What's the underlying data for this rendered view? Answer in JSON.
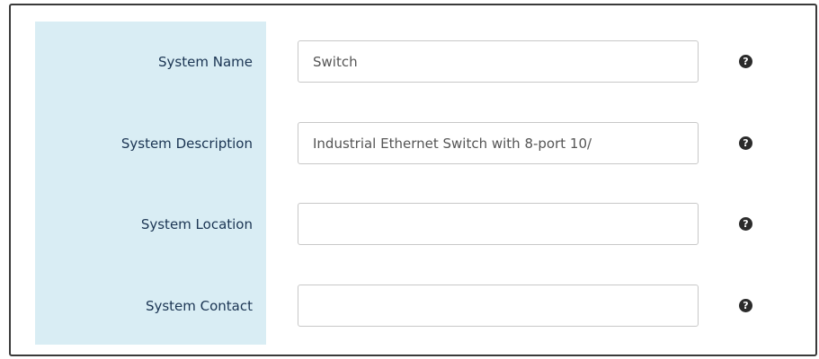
{
  "form": {
    "fields": [
      {
        "label": "System Name",
        "value": "Switch",
        "help_icon": "question-circle-icon"
      },
      {
        "label": "System Description",
        "value": "Industrial Ethernet Switch with 8-port 10/",
        "help_icon": "question-circle-icon"
      },
      {
        "label": "System Location",
        "value": "",
        "help_icon": "question-circle-icon"
      },
      {
        "label": "System Contact",
        "value": "",
        "help_icon": "question-circle-icon"
      }
    ],
    "help_glyph": "?"
  },
  "colors": {
    "label_background": "#d9edf4",
    "label_text": "#1b3553",
    "panel_border": "#3a3a3a",
    "help_icon": "#2b2b2b"
  }
}
